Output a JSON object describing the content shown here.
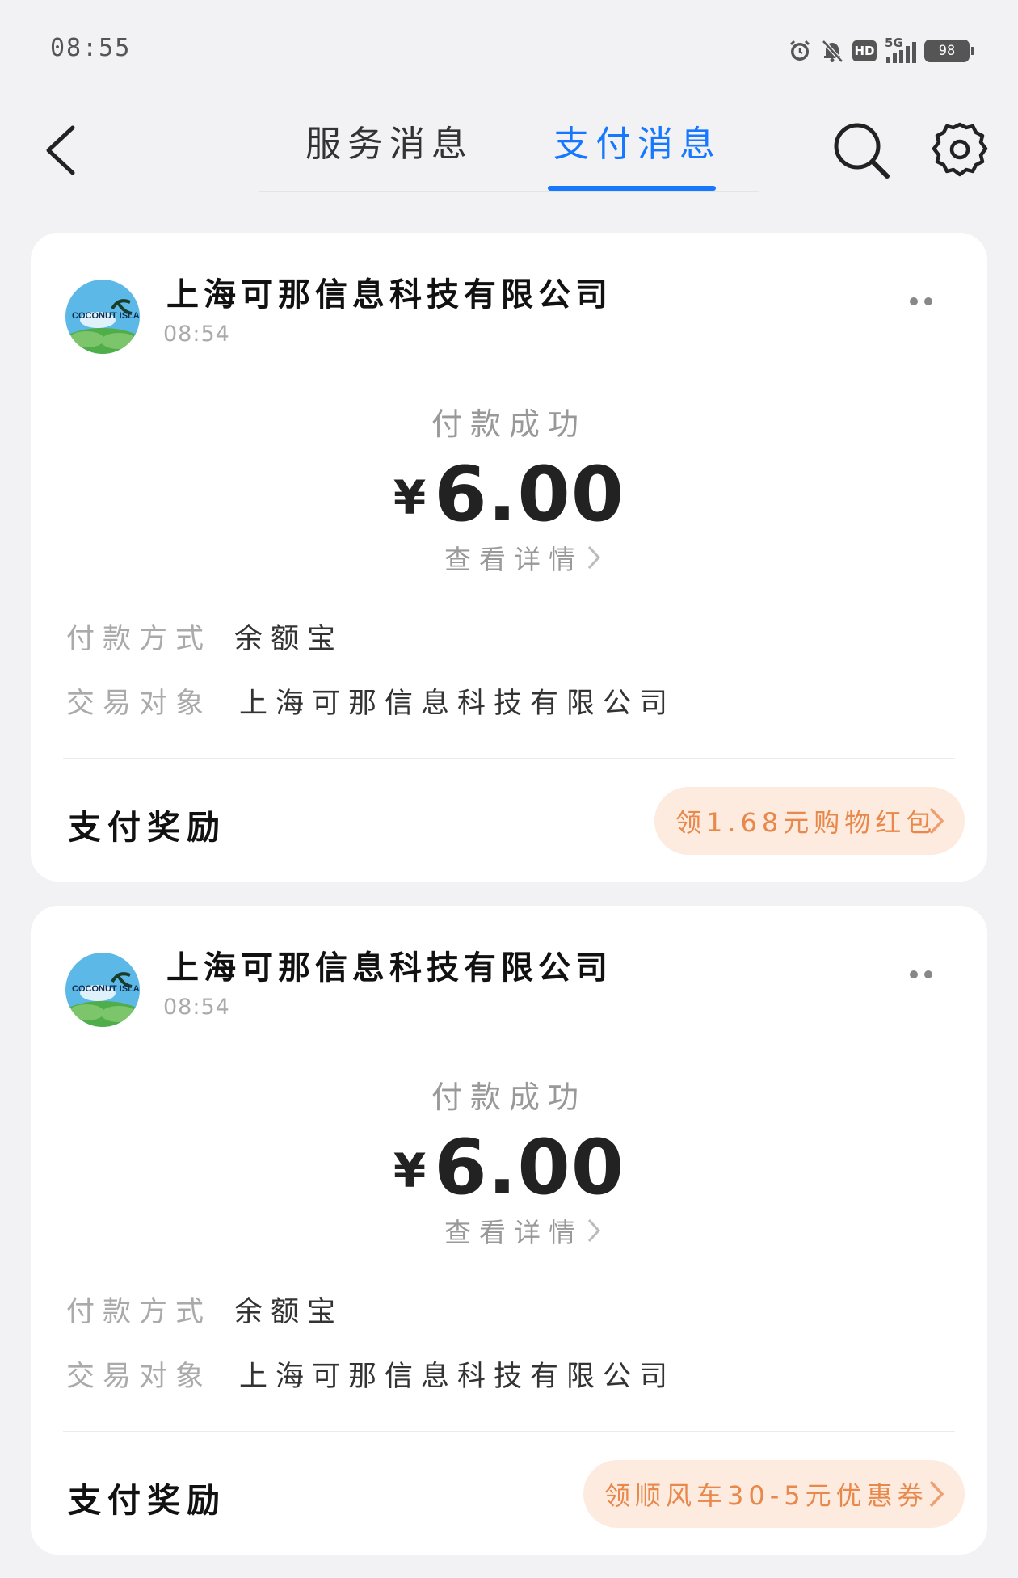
{
  "status_bar": {
    "time": "08:55",
    "network": "5G",
    "hd": "HD",
    "battery": "98",
    "icons": [
      "alarm-icon",
      "mute-bell-icon",
      "hd-icon",
      "signal-5g-icon",
      "battery-icon"
    ]
  },
  "header": {
    "back_icon": "chevron-left-icon",
    "tabs": [
      {
        "label": "服务消息",
        "active": false
      },
      {
        "label": "支付消息",
        "active": true
      }
    ],
    "search_icon": "search-icon",
    "settings_icon": "gear-icon"
  },
  "colors": {
    "accent": "#1677ff",
    "reward_bg": "#fdebe0",
    "reward_text": "#e8894b",
    "background": "#f2f2f4"
  },
  "cards": [
    {
      "merchant": "上海可那信息科技有限公司",
      "avatar_text": "COCONUT ISLAND",
      "time": "08:54",
      "status": "付款成功",
      "currency": "¥",
      "amount": "6.00",
      "detail_link": "查看详情",
      "method_label": "付款方式",
      "method_value": "余额宝",
      "party_label": "交易对象",
      "party_value": "上海可那信息科技有限公司",
      "reward_title": "支付奖励",
      "reward_button": "领1.68元购物红包"
    },
    {
      "merchant": "上海可那信息科技有限公司",
      "avatar_text": "COCONUT ISLAND",
      "time": "08:54",
      "status": "付款成功",
      "currency": "¥",
      "amount": "6.00",
      "detail_link": "查看详情",
      "method_label": "付款方式",
      "method_value": "余额宝",
      "party_label": "交易对象",
      "party_value": "上海可那信息科技有限公司",
      "reward_title": "支付奖励",
      "reward_button": "领顺风车30-5元优惠券"
    }
  ]
}
